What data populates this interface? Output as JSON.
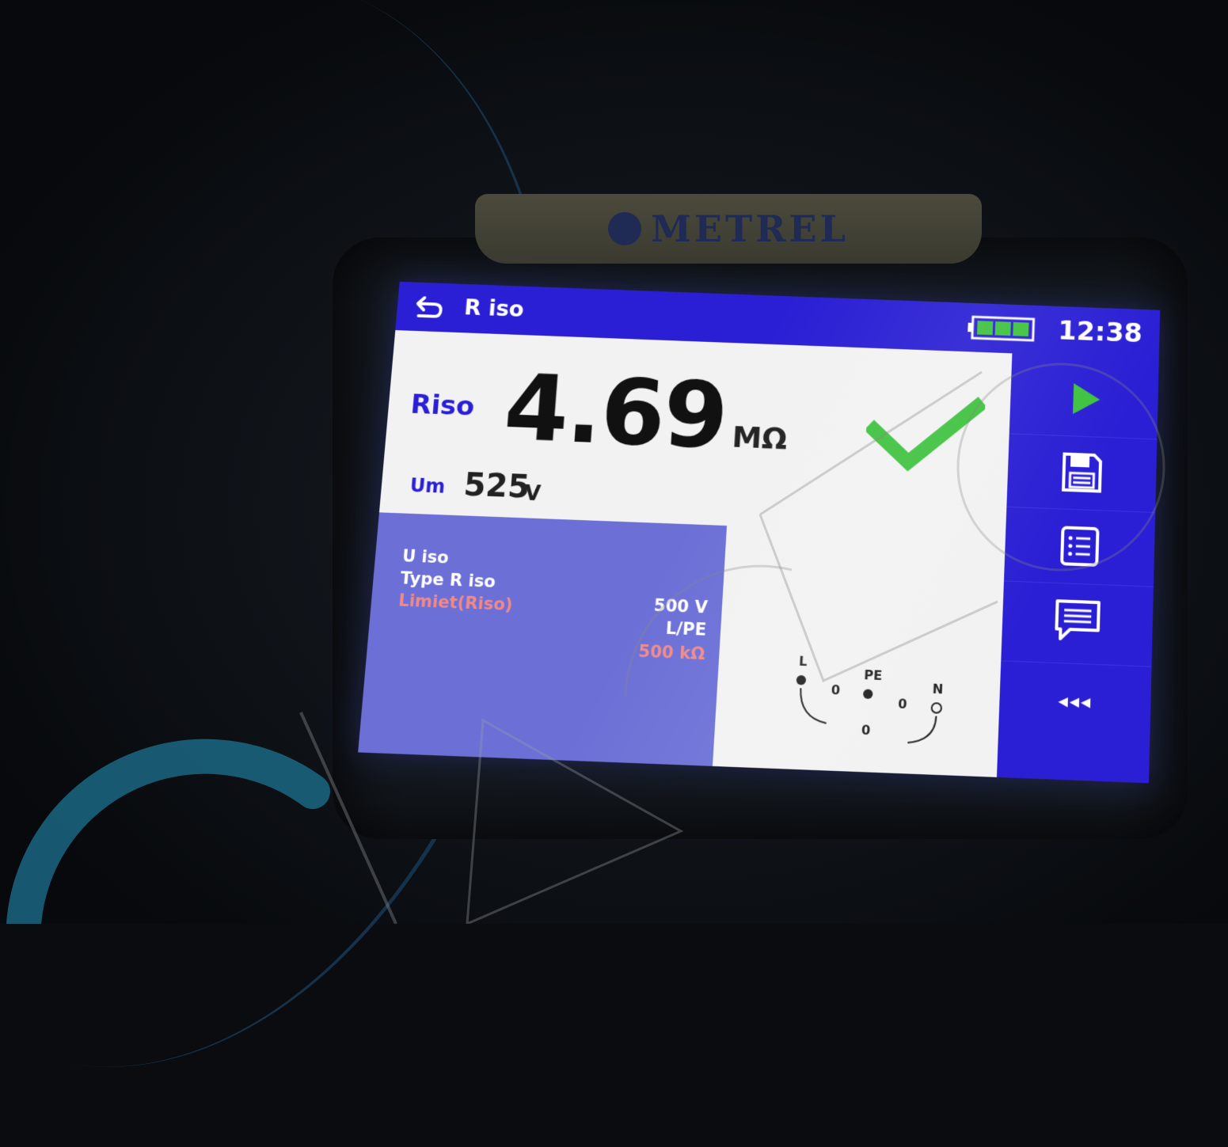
{
  "device": {
    "brand": "METREL"
  },
  "header": {
    "title": "R iso",
    "time": "12:38",
    "battery_level": 1.0
  },
  "result": {
    "label": "Riso",
    "value": "4.69",
    "unit": "MΩ",
    "status": "pass"
  },
  "measured_voltage": {
    "label": "Um",
    "value": "525",
    "unit": "V"
  },
  "parameters": [
    {
      "name": "U iso",
      "value": "500 V"
    },
    {
      "name": "Type R iso",
      "value": "L/PE"
    },
    {
      "name": "Limiet(Riso)",
      "value": "500 kΩ"
    }
  ],
  "terminals": {
    "labels": [
      "L",
      "PE",
      "N"
    ],
    "readings": [
      "0",
      "0",
      "0"
    ]
  },
  "sidebar": {
    "more_label": "◂◂◂"
  },
  "colors": {
    "accent": "#2a1fd4",
    "params_bg": "#6b6fd6",
    "pass": "#3fc23f",
    "limit": "#f08a8a"
  }
}
